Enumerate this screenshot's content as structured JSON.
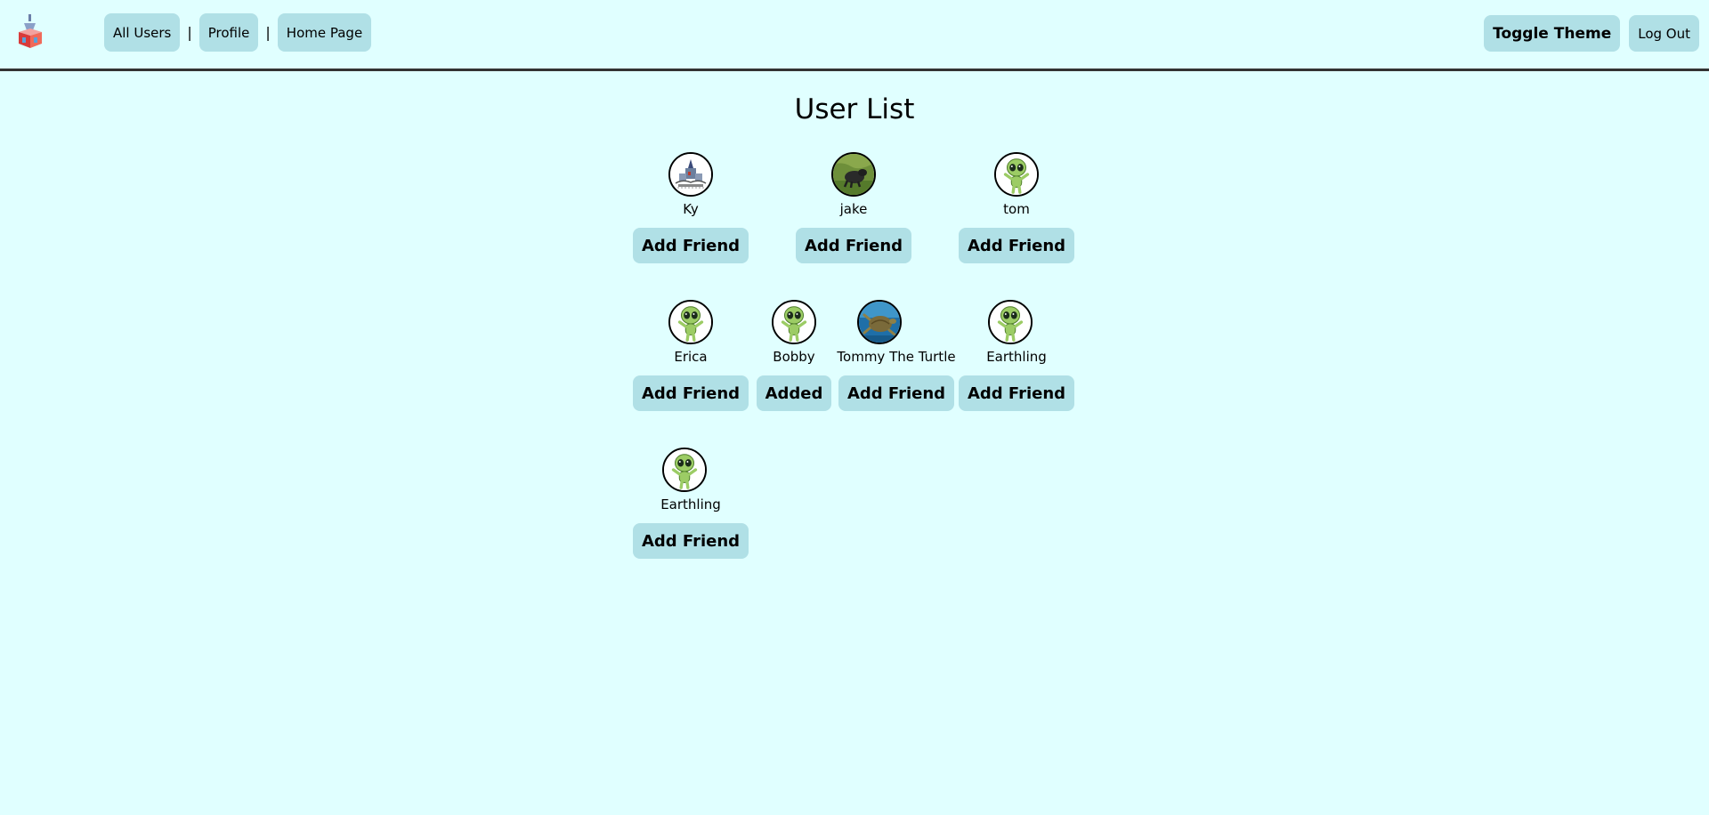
{
  "nav": {
    "all_users": "All Users",
    "separator": "|",
    "profile": "Profile",
    "home_page": "Home Page",
    "toggle_theme": "Toggle Theme",
    "log_out": "Log Out"
  },
  "page": {
    "title": "User List"
  },
  "users": [
    {
      "name": "Ky",
      "action": "Add Friend",
      "avatar": "castle-drawing"
    },
    {
      "name": "jake",
      "action": "Add Friend",
      "avatar": "dog-photo"
    },
    {
      "name": "tom",
      "action": "Add Friend",
      "avatar": "alien"
    },
    {
      "name": "Erica",
      "action": "Add Friend",
      "avatar": "alien"
    },
    {
      "name": "Bobby",
      "action": "Added",
      "avatar": "alien"
    },
    {
      "name": "Tommy The Turtle",
      "action": "Add Friend",
      "avatar": "turtle-photo"
    },
    {
      "name": "Earthling",
      "action": "Add Friend",
      "avatar": "alien"
    },
    {
      "name": "Earthling",
      "action": "Add Friend",
      "avatar": "alien"
    }
  ],
  "colors": {
    "background": "#e0ffff",
    "button": "#b0e0e6",
    "header_border": "#333333"
  }
}
